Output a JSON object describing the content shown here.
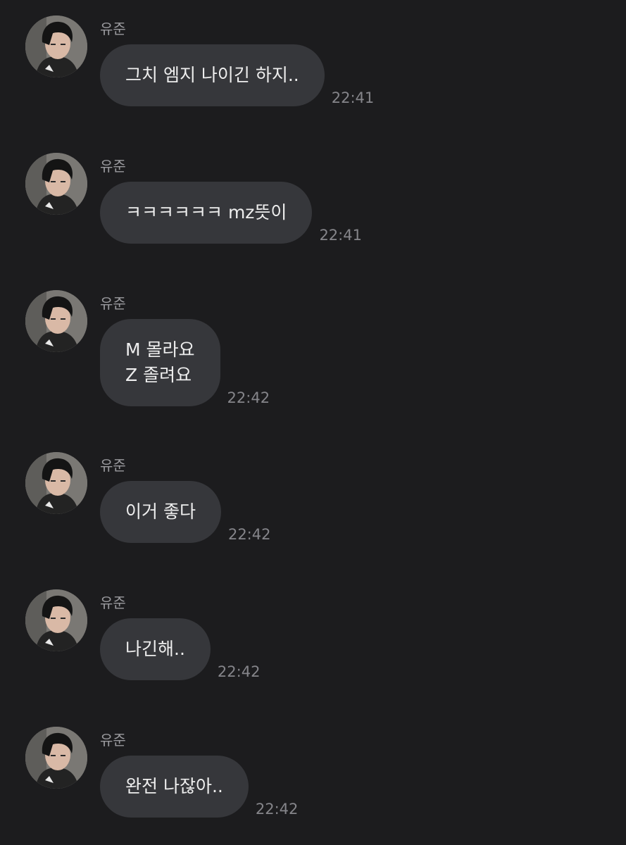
{
  "messages": [
    {
      "sender": "유준",
      "lines": [
        "그치 엠지 나이긴 하지.."
      ],
      "time": "22:41"
    },
    {
      "sender": "유준",
      "lines": [
        "ㅋㅋㅋㅋㅋㅋ mz뜻이"
      ],
      "time": "22:41"
    },
    {
      "sender": "유준",
      "lines": [
        "M 몰라요",
        "Z 졸려요"
      ],
      "time": "22:42"
    },
    {
      "sender": "유준",
      "lines": [
        "이거 좋다"
      ],
      "time": "22:42"
    },
    {
      "sender": "유준",
      "lines": [
        "나긴해.."
      ],
      "time": "22:42"
    },
    {
      "sender": "유준",
      "lines": [
        "완전 나잖아.."
      ],
      "time": "22:42"
    }
  ],
  "avatar": {
    "icon": "profile-photo"
  },
  "colors": {
    "background": "#1c1c1e",
    "bubble": "#36373b",
    "bubble_text": "#eeeeee",
    "sender_text": "#9a9a9e",
    "time_text": "#85858a"
  }
}
